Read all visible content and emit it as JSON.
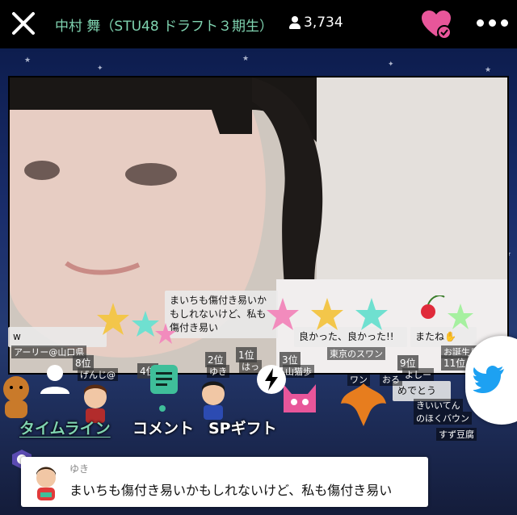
{
  "header": {
    "title": "中村 舞（STU48 ドラフト３期生）",
    "viewer_count": "3,734"
  },
  "overlay_comments": [
    {
      "text": "まいちも傷付き易いかもしれないけど、私も傷付き易い"
    },
    {
      "text": "良かった、良かった!!"
    },
    {
      "text": "またね✋"
    },
    {
      "text": "w"
    },
    {
      "text": "めでとう"
    }
  ],
  "overlay_tags": [
    "アーリー@山口県",
    "げんじ@",
    "ゆき",
    "はっ",
    "山猫歩",
    "東京のスワン",
    "ワン",
    "おる",
    "よしー",
    "お誕生日",
    "きいいてん",
    "のほくバウン",
    "すず豆腐"
  ],
  "ranks": [
    "8位",
    "1位",
    "2位",
    "3位",
    "4位",
    "9位",
    "11位"
  ],
  "tabs": [
    {
      "label": "タイムライン",
      "active": true
    },
    {
      "label": "コメント",
      "active": false
    },
    {
      "label": "SPギフト",
      "active": false
    }
  ],
  "latest_comment": {
    "user": "ゆき",
    "text": "まいちも傷付き易いかもしれないけど、私も傷付き易い"
  },
  "colors": {
    "accent": "#7fd3b0",
    "heart": "#e8569a",
    "twitter": "#1da1f2"
  },
  "icons": [
    "close-icon",
    "person-icon",
    "heart-check-icon",
    "more-icon",
    "timeline-icon",
    "comment-icon",
    "lightning-icon",
    "twitter-icon"
  ]
}
